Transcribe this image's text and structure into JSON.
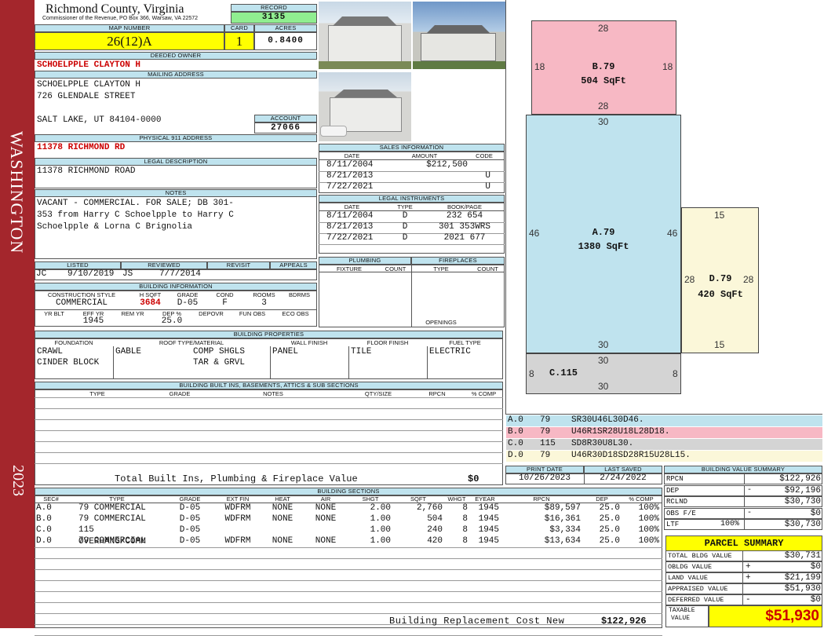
{
  "side": {
    "county": "WASHINGTON",
    "year": "2023"
  },
  "header": {
    "title": "Richmond County, Virginia",
    "subtitle": "Commissioner of the Revenue, PO Box 366, Warsaw, VA 22572",
    "record_label": "RECORD",
    "record": "3135",
    "map_label": "MAP NUMBER",
    "map": "26(12)A",
    "card_label": "CARD",
    "card": "1",
    "acres_label": "ACRES",
    "acres": "0.8400"
  },
  "owner": {
    "label": "DEEDED OWNER",
    "name": "SCHOELPPLE CLAYTON H"
  },
  "mailing": {
    "label": "MAILING ADDRESS",
    "line1": "SCHOELPPLE CLAYTON H",
    "line2": "726 GLENDALE STREET",
    "line3": "SALT LAKE, UT 84104-0000"
  },
  "account": {
    "label": "ACCOUNT",
    "value": "27066"
  },
  "physical": {
    "label": "PHYSICAL 911 ADDRESS",
    "value": "11378 RICHMOND RD"
  },
  "legal": {
    "label": "LEGAL DESCRIPTION",
    "value": "11378 RICHMOND ROAD"
  },
  "notes": {
    "label": "NOTES",
    "line1": "VACANT - COMMERCIAL. FOR SALE; DB 301-",
    "line2": "353 from Harry C Schoelpple to Harry C",
    "line3": "Schoelpple & Lorna C Brignolia"
  },
  "listed": {
    "listed_label": "LISTED",
    "reviewed_label": "REVIEWED",
    "revisit_label": "REVISIT",
    "appeals_label": "APPEALS",
    "listed_by": "JC",
    "listed_date": "9/10/2019",
    "reviewed_by": "JS",
    "reviewed_date": "7/7/2014"
  },
  "bldg_info": {
    "label": "BUILDING INFORMATION",
    "h1": "CONSTRUCTION STYLE",
    "h2": "H SQFT",
    "h3": "GRADE",
    "h4": "COND",
    "h5": "ROOMS",
    "h6": "BDRMS",
    "style": "COMMERCIAL",
    "hsqft": "3684",
    "grade": "D-05",
    "cond": "F",
    "rooms": "3",
    "k1": "YR BLT",
    "k2": "EFF YR",
    "k3": "REM YR",
    "k4": "DEP %",
    "k5": "DEPOVR",
    "k6": "FUN OBS",
    "k7": "ECO OBS",
    "eff": "1945",
    "dep": "25.0"
  },
  "sales": {
    "label": "SALES INFORMATION",
    "h_date": "DATE",
    "h_amount": "AMOUNT",
    "h_code": "CODE",
    "rows": [
      {
        "date": "8/11/2004",
        "amount": "$212,500",
        "code": ""
      },
      {
        "date": "8/21/2013",
        "amount": "",
        "code": "U"
      },
      {
        "date": "7/22/2021",
        "amount": "",
        "code": "U"
      }
    ]
  },
  "legal_inst": {
    "label": "LEGAL INSTRUMENTS",
    "h_date": "DATE",
    "h_type": "TYPE",
    "h_book": "BOOK/PAGE",
    "rows": [
      {
        "date": "8/11/2004",
        "type": "D",
        "book": "232 654"
      },
      {
        "date": "8/21/2013",
        "type": "D",
        "book": "301 353WRS"
      },
      {
        "date": "7/22/2021",
        "type": "D",
        "book": "2021 677"
      }
    ]
  },
  "plumb": {
    "label": "PLUMBING",
    "fixture": "FIXTURE",
    "count": "COUNT"
  },
  "fire": {
    "label": "FIREPLACES",
    "type": "TYPE",
    "count": "COUNT",
    "openings": "OPENINGS"
  },
  "props": {
    "label": "BUILDING PROPERTIES",
    "h1": "FOUNDATION",
    "h2": "ROOF TYPE/MATERIAL",
    "h3": "WALL FINISH",
    "h4": "FLOOR FINISH",
    "h5": "FUEL TYPE",
    "found1": "CRAWL",
    "found2": "CINDER BLOCK",
    "roof_type": "GABLE",
    "roof1": "COMP SHGLS",
    "roof2": "TAR & GRVL",
    "wall": "PANEL",
    "floor": "TILE",
    "fuel": "ELECTRIC"
  },
  "builtins": {
    "label": "BUILDING BUILT INS, BASEMENTS, ATTICS & SUB SECTIONS",
    "h1": "TYPE",
    "h2": "GRADE",
    "h3": "NOTES",
    "h4": "QTY/SIZE",
    "h5": "RPCN",
    "h6": "% COMP",
    "total_label": "Total Built Ins, Plumbing & Fireplace Value",
    "total": "$0"
  },
  "print": {
    "print_label": "PRINT DATE",
    "print": "10/26/2023",
    "saved_label": "LAST SAVED",
    "saved": "2/24/2022"
  },
  "sketch": {
    "A": {
      "label": "A.79",
      "area": "1380 SqFt",
      "top": "30",
      "bottom": "30",
      "left": "46",
      "right": "46"
    },
    "B": {
      "label": "B.79",
      "area": "504 SqFt",
      "top": "28",
      "bottom": "28",
      "left": "18",
      "right": "18"
    },
    "C": {
      "label": "C.115",
      "top": "30",
      "bottom": "30",
      "left": "8",
      "right": "8"
    },
    "D": {
      "label": "D.79",
      "area": "420 SqFt",
      "top": "15",
      "bottom": "15",
      "left": "28",
      "right": "28"
    }
  },
  "legend": [
    {
      "code": "A.0",
      "num": "79",
      "path": "SR30U46L30D46.",
      "color": "#bfe3ee"
    },
    {
      "code": "B.0",
      "num": "79",
      "path": "U46R1SR28U18L28D18.",
      "color": "#f7b8c4"
    },
    {
      "code": "C.0",
      "num": "115",
      "path": "SD8R30U8L30.",
      "color": "#d4d4d4"
    },
    {
      "code": "D.0",
      "num": "79",
      "path": "U46R30D18SD28R15U28L15.",
      "color": "#fbf7d9"
    }
  ],
  "sections": {
    "label": "BUILDING SECTIONS",
    "headers": [
      "SEC#",
      "TYPE",
      "GRADE",
      "EXT FIN",
      "HEAT",
      "AIR",
      "SHGT",
      "SQFT",
      "WHGT",
      "EYEAR",
      "RPCN",
      "DEP",
      "% COMP"
    ],
    "rows": [
      {
        "sec": "A.0",
        "type": "79 COMMERCIAL",
        "grade": "D-05",
        "ext": "WDFRM",
        "heat": "NONE",
        "air": "NONE",
        "shgt": "2.00",
        "sqft": "2,760",
        "whgt": "8",
        "eyear": "1945",
        "rpcn": "$89,597",
        "dep": "25.0",
        "comp": "100%"
      },
      {
        "sec": "B.0",
        "type": "79 COMMERCIAL",
        "grade": "D-05",
        "ext": "WDFRM",
        "heat": "NONE",
        "air": "NONE",
        "shgt": "1.00",
        "sqft": "504",
        "whgt": "8",
        "eyear": "1945",
        "rpcn": "$16,361",
        "dep": "25.0",
        "comp": "100%"
      },
      {
        "sec": "C.0",
        "type": "115 OVERHANG/COMM",
        "grade": "D-05",
        "ext": "",
        "heat": "",
        "air": "",
        "shgt": "1.00",
        "sqft": "240",
        "whgt": "8",
        "eyear": "1945",
        "rpcn": "$3,334",
        "dep": "25.0",
        "comp": "100%"
      },
      {
        "sec": "D.0",
        "type": "79 COMMERCIAL",
        "grade": "D-05",
        "ext": "WDFRM",
        "heat": "NONE",
        "air": "NONE",
        "shgt": "1.00",
        "sqft": "420",
        "whgt": "8",
        "eyear": "1945",
        "rpcn": "$13,634",
        "dep": "25.0",
        "comp": "100%"
      }
    ],
    "total_label": "Building Replacement Cost New",
    "total": "$122,926"
  },
  "bvs": {
    "label": "BUILDING VALUE SUMMARY",
    "rows": [
      {
        "k": "RPCN",
        "s": "",
        "v": "$122,926"
      },
      {
        "k": "DEP",
        "s": "-",
        "v": "$92,196"
      },
      {
        "k": "RCLND",
        "s": "",
        "v": "$30,730"
      },
      {
        "k": "OBS F/E",
        "s": "-",
        "v": "$0"
      },
      {
        "k": "LTF",
        "s": "100%",
        "v": "$30,730"
      }
    ]
  },
  "parcel": {
    "label": "PARCEL SUMMARY",
    "rows": [
      {
        "k": "TOTAL BLDG VALUE",
        "s": "",
        "v": "$30,731"
      },
      {
        "k": "OBLDG VALUE",
        "s": "+",
        "v": "$0"
      },
      {
        "k": "LAND VALUE",
        "s": "+",
        "v": "$21,199"
      },
      {
        "k": "APPRAISED VALUE",
        "s": "",
        "v": "$51,930"
      },
      {
        "k": "DEFERRED VALUE",
        "s": "-",
        "v": "$0"
      }
    ],
    "taxable_label1": "TAXABLE",
    "taxable_label2": "VALUE",
    "taxable": "$51,930"
  },
  "colors": {
    "sidebar": "#a4262c",
    "header": "#bfe3ee",
    "yellow": "#ffff00",
    "record": "#90ee90"
  }
}
